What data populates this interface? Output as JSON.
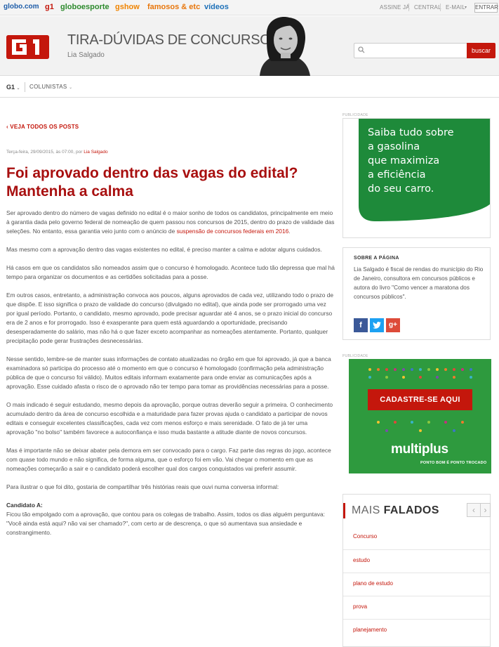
{
  "globalbar": {
    "brands": [
      "globo.com",
      "g1",
      "globoesporte",
      "gshow",
      "famosos & etc",
      "vídeos"
    ],
    "assine": "ASSINE JÁ",
    "central": "CENTRAL",
    "email": "E-MAIL",
    "entrar": "ENTRAR"
  },
  "header": {
    "logo": "g1",
    "title": "TIRA-DÚVIDAS DE CONCURSOS",
    "author": "Lia Salgado",
    "search_placeholder": "",
    "search_button": "buscar"
  },
  "nav": {
    "g1": "G1",
    "colunistas": "COLUNISTAS"
  },
  "article": {
    "back_link": "VEJA TODOS OS POSTS",
    "meta_prefix": "Terça-feira, 29/09/2015, às 07:00, por",
    "meta_author": "Lia Salgado",
    "title": "Foi aprovado dentro das vagas do edital? Mantenha a calma",
    "p1": "Ser aprovado dentro do número de vagas definido no edital é o maior sonho de todos os candidatos, principalmente em meio à garantia dada pelo governo federal de nomeação de quem passou nos concursos de 2015, dentro do prazo de validade das seleções. No entanto, essa garantia veio junto com o anúncio de",
    "p1_link": "suspensão de concursos federais em 2016",
    "p1_end": ".",
    "p2": "Mas mesmo com a aprovação dentro das vagas existentes no edital, é preciso manter a calma e adotar alguns cuidados.",
    "p3": "Há casos em que os candidatos são nomeados assim que o concurso é homologado. Acontece tudo tão depressa que mal há tempo para organizar os documentos e as certidões solicitadas para a posse.",
    "p4": "Em outros casos, entretanto, a administração convoca aos poucos, alguns aprovados de cada vez, utilizando todo o prazo de que dispõe. E isso significa o prazo de validade do concurso (divulgado no edital), que ainda pode ser prorrogado uma vez por igual período. Portanto, o candidato, mesmo aprovado, pode precisar aguardar até 4 anos, se o prazo inicial do concurso era de 2 anos e for prorrogado. Isso é exasperante para quem está aguardando a oportunidade, precisando desesperadamente do salário, mas não há o que fazer exceto acompanhar as nomeações atentamente. Portanto, qualquer precipitação pode gerar frustrações desnecessárias.",
    "p5": "Nesse sentido, lembre-se de manter suas informações de contato atualizadas no órgão em que foi aprovado, já que a banca examinadora só participa do processo até o momento em que o concurso é homologado (confirmação pela administração pública de que o concurso foi válido). Muitos editais informam exatamente para onde enviar as comunicações após a aprovação. Esse cuidado afasta o risco de o aprovado não ter tempo para tomar as providências necessárias para a posse.",
    "p6": "O mais indicado é seguir estudando, mesmo depois da aprovação, porque outras deverão seguir a primeira. O conhecimento acumulado dentro da área de concurso escolhida e a maturidade para fazer provas ajuda o candidato a participar de novos editais e conseguir excelentes classificações, cada vez com menos esforço e mais serenidade. O fato de já ter uma aprovação \"no bolso\" também favorece a autoconfiança e isso muda bastante a atitude diante de novos concursos.",
    "p7": "Mas é importante não se deixar abater pela demora em ser convocado para o cargo. Faz parte das regras do jogo, acontece com quase todo mundo e não significa, de forma alguma, que o esforço foi em vão. Vai chegar o momento em que as nomeações começarão a sair e o candidato poderá escolher qual dos cargos conquistados vai preferir assumir.",
    "p8": "Para ilustrar o que foi dito, gostaria de compartilhar três histórias reais que ouvi numa conversa informal:",
    "subhead": "Candidato A:",
    "p9": "Ficou tão empolgado com a aprovação, que contou para os colegas de trabalho. Assim, todos os dias alguém perguntava: \"Você ainda está aqui? não vai ser chamado?\", com certo ar de descrença, o que só aumentava sua ansiedade e constrangimento."
  },
  "sidebar": {
    "pub1": "PUBLICIDADE",
    "ad1_text": [
      "Saiba tudo sobre",
      "a gasolina",
      "que maximiza",
      "a eficiência",
      "do seu carro."
    ],
    "about_heading": "SOBRE A PÁGINA",
    "about_text": "Lia Salgado é fiscal de rendas do município do Rio de Janeiro, consultora em concursos públicos e autora do livro \"Como vencer a maratona dos concursos públicos\".",
    "pub2": "PUBLICIDADE",
    "ad2_button": "CADASTRE-SE AQUI",
    "ad2_brand": "multiplus",
    "ad2_slogan": "PONTO BOM É PONTO TROCADO",
    "mais_prefix": "MAIS",
    "mais_bold": "FALADOS",
    "mais_items": [
      "Concurso",
      "estudo",
      "plano de estudo",
      "prova",
      "planejamento"
    ]
  },
  "colors": {
    "brand_red": "#c4170c",
    "title_red": "#a80f0f",
    "ad_green": "#1e8a3a"
  }
}
